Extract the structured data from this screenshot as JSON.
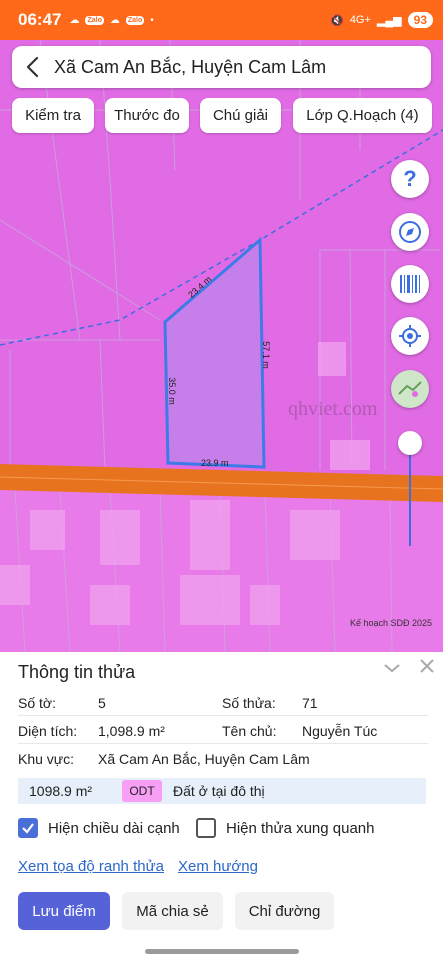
{
  "status": {
    "time": "06:47",
    "net": "4G+",
    "battery": "93",
    "app_pill": "Zalo"
  },
  "search": {
    "location": "Xã Cam An Bắc, Huyện Cam Lâm"
  },
  "toolbar": {
    "check": "Kiểm tra",
    "measure": "Thước đo",
    "legend": "Chú giải",
    "layers": "Lớp Q.Hoạch (4)"
  },
  "map": {
    "edge_top": "23.4 m",
    "edge_right": "57.1 m",
    "edge_left": "35.0 m",
    "edge_bottom": "23.9 m",
    "watermark": "qhviet.com",
    "caption": "Kế hoạch SDĐ 2025"
  },
  "panel": {
    "title": "Thông tin thửa",
    "so_to_label": "Số tờ:",
    "so_to": "5",
    "so_thua_label": "Số thửa:",
    "so_thua": "71",
    "dien_tich_label": "Diện tích:",
    "dien_tich": "1,098.9 m²",
    "chu_label": "Tên chủ:",
    "chu": "Nguyễn Túc",
    "khu_vuc_label": "Khu vực:",
    "khu_vuc": "Xã Cam An Bắc, Huyện Cam Lâm",
    "use_area": "1098.9 m²",
    "use_code": "ODT",
    "use_desc": "Đất ở tại đô thị",
    "chk_edges": "Hiện chiều dài cạnh",
    "chk_edges_on": true,
    "chk_neighbors": "Hiện thửa xung quanh",
    "chk_neighbors_on": false,
    "link_coords": "Xem tọa độ ranh thửa",
    "link_dir": "Xem hướng",
    "btn_save": "Lưu điểm",
    "btn_share": "Mã chia sẻ",
    "btn_route": "Chỉ đường"
  },
  "colors": {
    "accent": "#ff6a1a",
    "zone_pink": "#e66fe8",
    "road": "#e8731e",
    "primary": "#5663d8"
  }
}
